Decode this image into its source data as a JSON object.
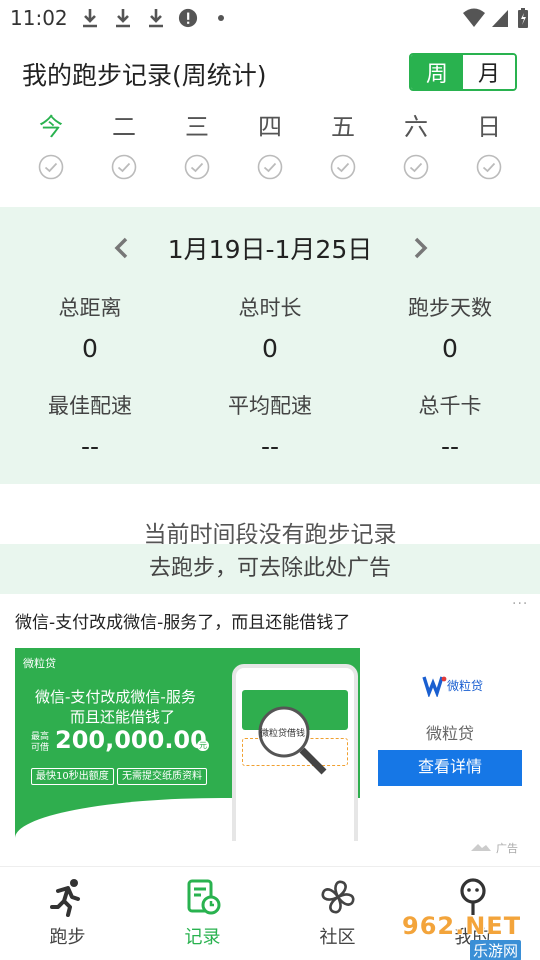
{
  "status_bar": {
    "time": "11:02"
  },
  "header": {
    "title": "我的跑步记录(周统计)",
    "toggle": {
      "week": "周",
      "month": "月",
      "selected": "week"
    }
  },
  "week": {
    "days": [
      {
        "label": "今",
        "today": true
      },
      {
        "label": "二",
        "today": false
      },
      {
        "label": "三",
        "today": false
      },
      {
        "label": "四",
        "today": false
      },
      {
        "label": "五",
        "today": false
      },
      {
        "label": "六",
        "today": false
      },
      {
        "label": "日",
        "today": false
      }
    ]
  },
  "summary": {
    "range": "1月19日-1月25日",
    "stats": [
      {
        "label": "总距离",
        "value": "0"
      },
      {
        "label": "总时长",
        "value": "0"
      },
      {
        "label": "跑步天数",
        "value": "0"
      },
      {
        "label": "最佳配速",
        "value": "--"
      },
      {
        "label": "平均配速",
        "value": "--"
      },
      {
        "label": "总千卡",
        "value": "--"
      }
    ]
  },
  "empty_message": "当前时间段没有跑步记录",
  "remove_ad_text": "去跑步，可去除此处广告",
  "ad": {
    "title": "微信-支付改成微信-服务了，而且还能借钱了",
    "more": "···",
    "image": {
      "brand_small": "微粒贷",
      "line1": "微信-支付改成微信-服务",
      "line2": "而且还能借钱了",
      "max_label": "最高\n可借",
      "amount": "200,000.00",
      "yuan": "元",
      "pill1": "最快10秒出额度",
      "pill2": "无需提交纸质资料",
      "phone_label": "微粒贷借钱"
    },
    "brand": "微粒贷",
    "cta": "查看详情",
    "tag": "广告"
  },
  "nav": {
    "items": [
      {
        "label": "跑步",
        "active": false
      },
      {
        "label": "记录",
        "active": true
      },
      {
        "label": "社区",
        "active": false
      },
      {
        "label": "我的",
        "active": false
      }
    ]
  },
  "watermark": {
    "text": "962.NET",
    "sub": "乐游网"
  },
  "colors": {
    "accent": "#29b24f",
    "panel": "#e9f6ee",
    "cta": "#1677e6"
  }
}
